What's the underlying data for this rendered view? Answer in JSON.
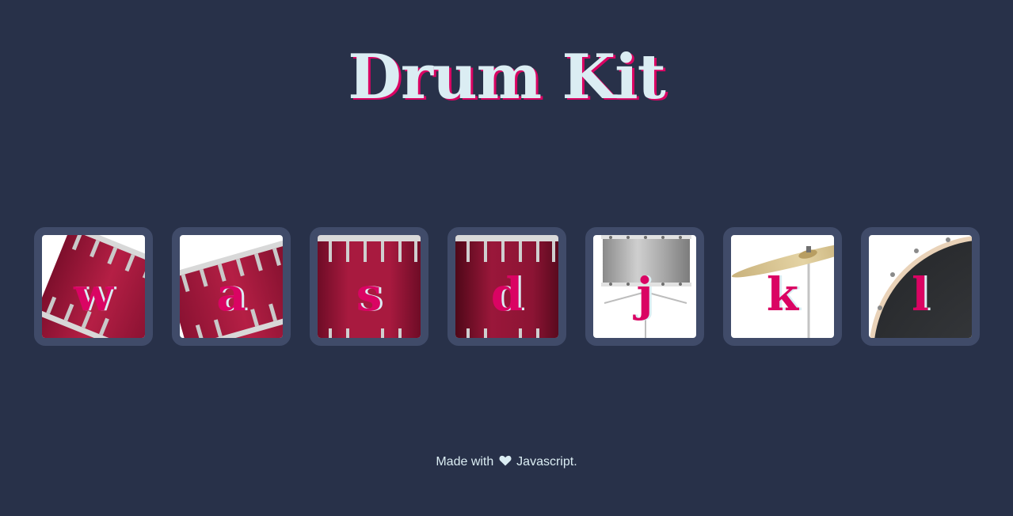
{
  "page": {
    "title": "Drum Kit",
    "colors": {
      "background": "#283149",
      "tile_border": "#404B69",
      "title": "#DBEDF3",
      "accent": "#DA0463"
    }
  },
  "drums": [
    {
      "key": "w",
      "icon": "tom1-drum-icon"
    },
    {
      "key": "a",
      "icon": "tom2-drum-icon"
    },
    {
      "key": "s",
      "icon": "tom3-drum-icon"
    },
    {
      "key": "d",
      "icon": "tom4-drum-icon"
    },
    {
      "key": "j",
      "icon": "snare-drum-icon"
    },
    {
      "key": "k",
      "icon": "crash-cymbal-icon"
    },
    {
      "key": "l",
      "icon": "kick-drum-icon"
    }
  ],
  "footer": {
    "prefix": "Made with",
    "icon": "heart-icon",
    "suffix": "Javascript."
  }
}
